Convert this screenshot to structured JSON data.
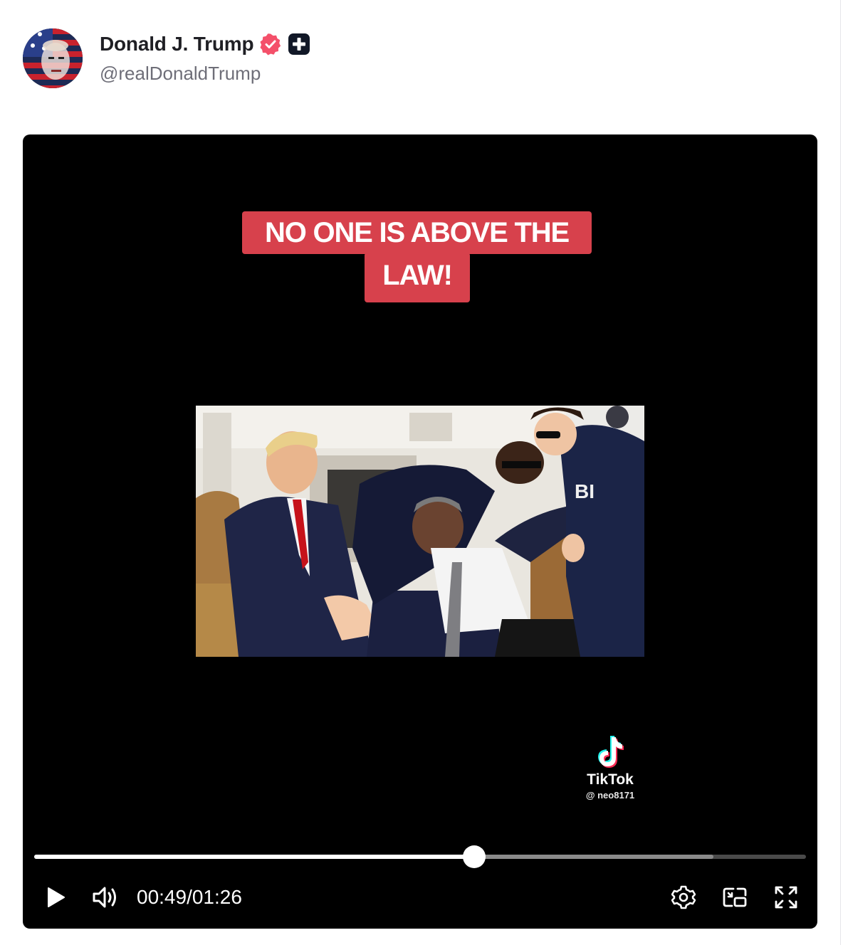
{
  "post": {
    "author": {
      "display_name": "Donald J. Trump",
      "handle": "@realDonaldTrump",
      "verified_badge_color": "#f43f5e",
      "avatar_icon": "avatar-image"
    }
  },
  "video": {
    "caption_line1": "NO ONE IS ABOVE THE",
    "caption_line2": "LAW!",
    "caption_color": "#d7414c",
    "watermark": {
      "brand": "TikTok",
      "user": "@ neo8171"
    },
    "player": {
      "current_time": "00:49",
      "separator": "/",
      "duration": "01:26",
      "played_fraction": 0.57,
      "buffered_fraction": 0.88,
      "icons": [
        "play-icon",
        "volume-icon",
        "settings-icon",
        "picture-in-picture-icon",
        "fullscreen-icon"
      ]
    }
  }
}
